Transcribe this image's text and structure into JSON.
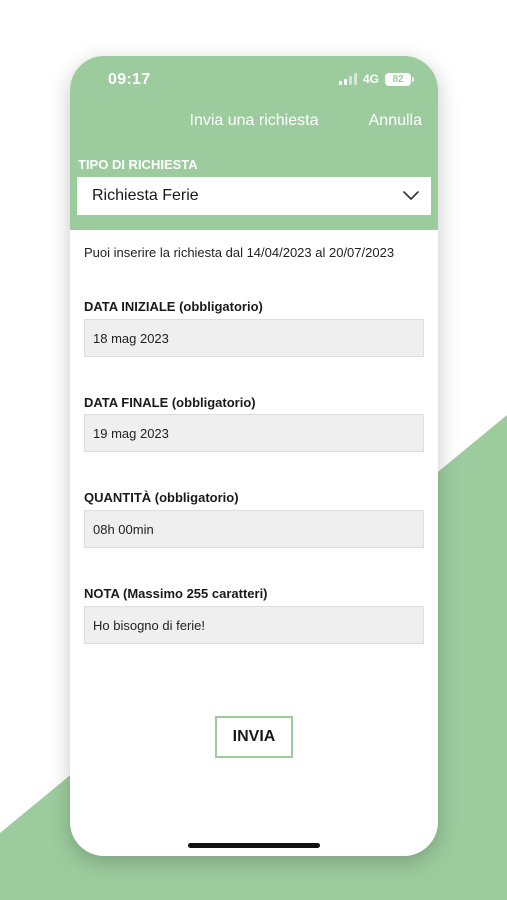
{
  "colors": {
    "accent": "#9ccc9d",
    "field_bg": "#efefef"
  },
  "status_bar": {
    "time": "09:17",
    "network": "4G",
    "battery": "82"
  },
  "nav": {
    "title": "Invia una richiesta",
    "cancel": "Annulla"
  },
  "request_type": {
    "label": "TIPO DI RICHIESTA",
    "selected": "Richiesta Ferie",
    "icon": "chevron-down-icon"
  },
  "info": "Puoi inserire la richiesta dal 14/04/2023 al 20/07/2023",
  "fields": {
    "start_date": {
      "label": "DATA INIZIALE (obbligatorio)",
      "value": "18 mag 2023"
    },
    "end_date": {
      "label": "DATA FINALE (obbligatorio)",
      "value": "19 mag 2023"
    },
    "quantity": {
      "label": "QUANTITÀ (obbligatorio)",
      "value": "08h 00min"
    },
    "note": {
      "label": "NOTA (Massimo 255 caratteri)",
      "value": "Ho bisogno di ferie!"
    }
  },
  "submit": "INVIA"
}
